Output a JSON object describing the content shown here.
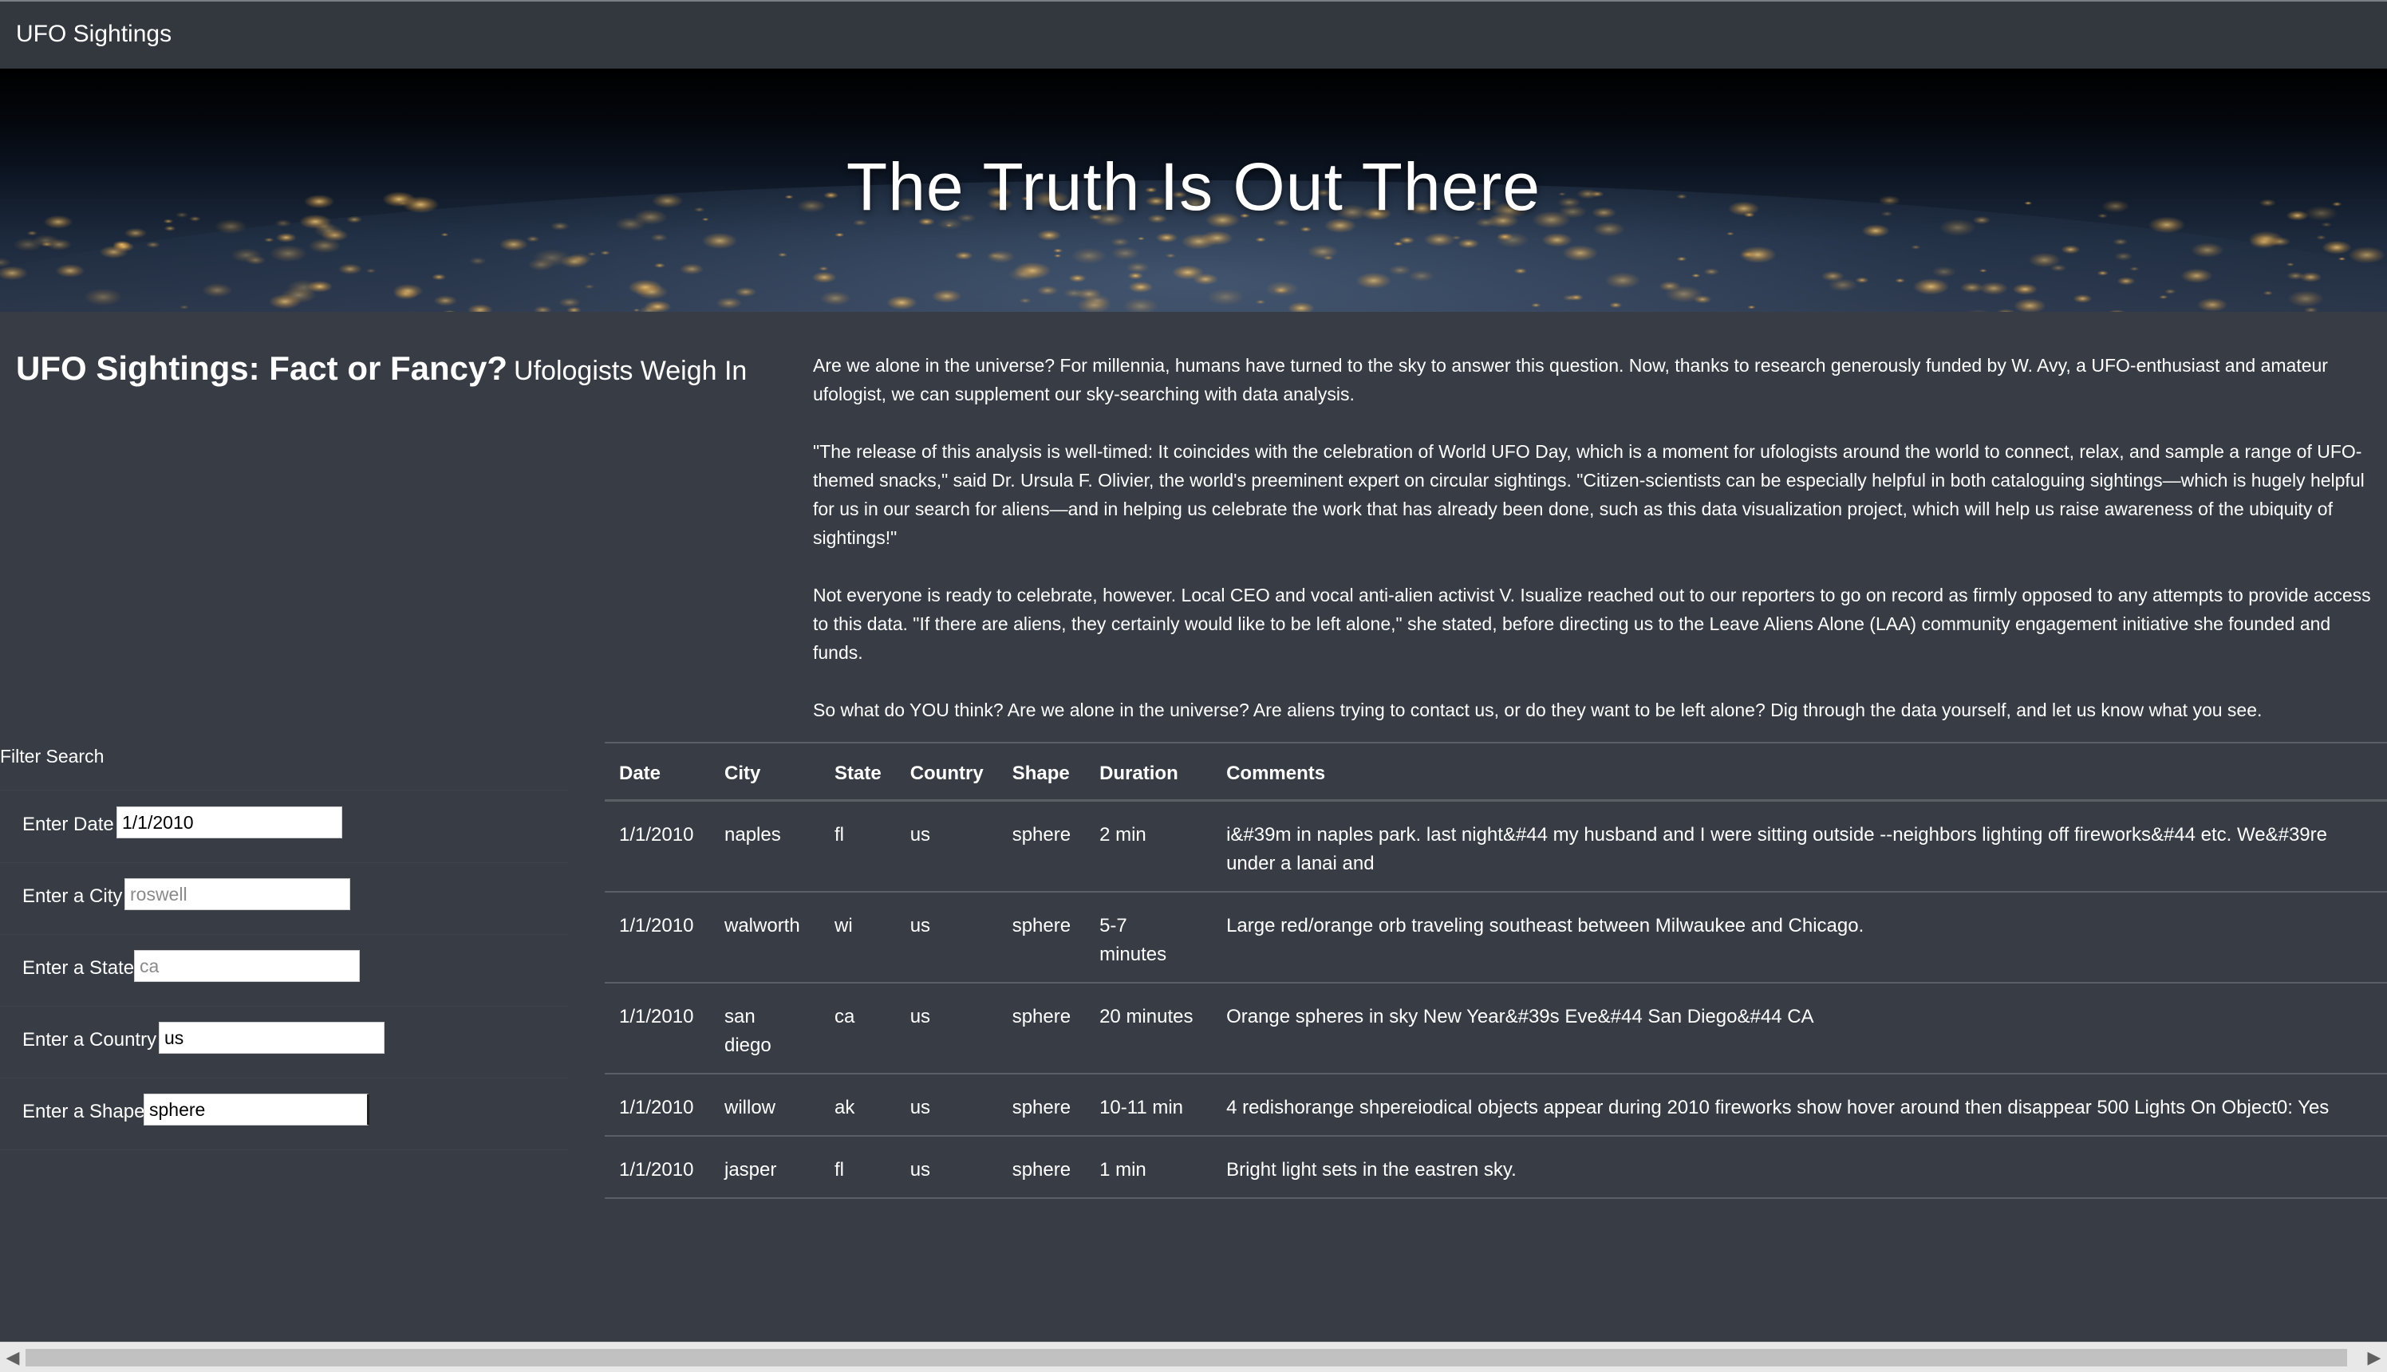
{
  "navbar": {
    "brand": "UFO Sightings"
  },
  "hero": {
    "title": "The Truth Is Out There"
  },
  "article": {
    "heading": "UFO Sightings: Fact or Fancy?",
    "subheading": "Ufologists Weigh In",
    "paragraphs": [
      "Are we alone in the universe? For millennia, humans have turned to the sky to answer this question. Now, thanks to research generously funded by W. Avy, a UFO-enthusiast and amateur ufologist, we can supplement our sky-searching with data analysis.",
      "\"The release of this analysis is well-timed: It coincides with the celebration of World UFO Day, which is a moment for ufologists around the world to connect, relax, and sample a range of UFO-themed snacks,\" said Dr. Ursula F. Olivier, the world's preeminent expert on circular sightings. \"Citizen-scientists can be especially helpful in both cataloguing sightings—which is hugely helpful for us in our search for aliens—and in helping us celebrate the work that has already been done, such as this data visualization project, which will help us raise awareness of the ubiquity of sightings!\"",
      "Not everyone is ready to celebrate, however. Local CEO and vocal anti-alien activist V. Isualize reached out to our reporters to go on record as firmly opposed to any attempts to provide access to this data. \"If there are aliens, they certainly would like to be left alone,\" she stated, before directing us to the Leave Aliens Alone (LAA) community engagement initiative she founded and funds.",
      "So what do YOU think? Are we alone in the universe? Are aliens trying to contact us, or do they want to be left alone? Dig through the data yourself, and let us know what you see."
    ]
  },
  "filters": {
    "title": "Filter Search",
    "date": {
      "label": "Enter Date",
      "value": "1/1/2010",
      "placeholder": ""
    },
    "city": {
      "label": "Enter a City",
      "value": "",
      "placeholder": "roswell"
    },
    "state": {
      "label": "Enter a State",
      "value": "",
      "placeholder": "ca"
    },
    "country": {
      "label": "Enter a Country",
      "value": "us",
      "placeholder": ""
    },
    "shape": {
      "label": "Enter a Shape",
      "value": "sphere",
      "placeholder": ""
    }
  },
  "table": {
    "headers": [
      "Date",
      "City",
      "State",
      "Country",
      "Shape",
      "Duration",
      "Comments"
    ],
    "rows": [
      [
        "1/1/2010",
        "naples",
        "fl",
        "us",
        "sphere",
        "2 min",
        "i&#39m in naples park. last night&#44 my husband and I were sitting outside --neighbors lighting off fireworks&#44 etc. We&#39re under a lanai and"
      ],
      [
        "1/1/2010",
        "walworth",
        "wi",
        "us",
        "sphere",
        "5-7 minutes",
        "Large red/orange orb traveling southeast between Milwaukee and Chicago."
      ],
      [
        "1/1/2010",
        "san diego",
        "ca",
        "us",
        "sphere",
        "20 minutes",
        "Orange spheres in sky New Year&#39s Eve&#44 San Diego&#44 CA"
      ],
      [
        "1/1/2010",
        "willow",
        "ak",
        "us",
        "sphere",
        "10-11 min",
        "4 redishorange shpereiodical objects appear during 2010 fireworks show hover around then disappear 500 Lights On Object0: Yes"
      ],
      [
        "1/1/2010",
        "jasper",
        "fl",
        "us",
        "sphere",
        "1 min",
        "Bright light sets in the eastren sky."
      ]
    ]
  },
  "scrollbar": {
    "left_arrow_icon": "scroll-left-arrow-icon",
    "right_arrow_icon": "scroll-right-arrow-icon"
  }
}
